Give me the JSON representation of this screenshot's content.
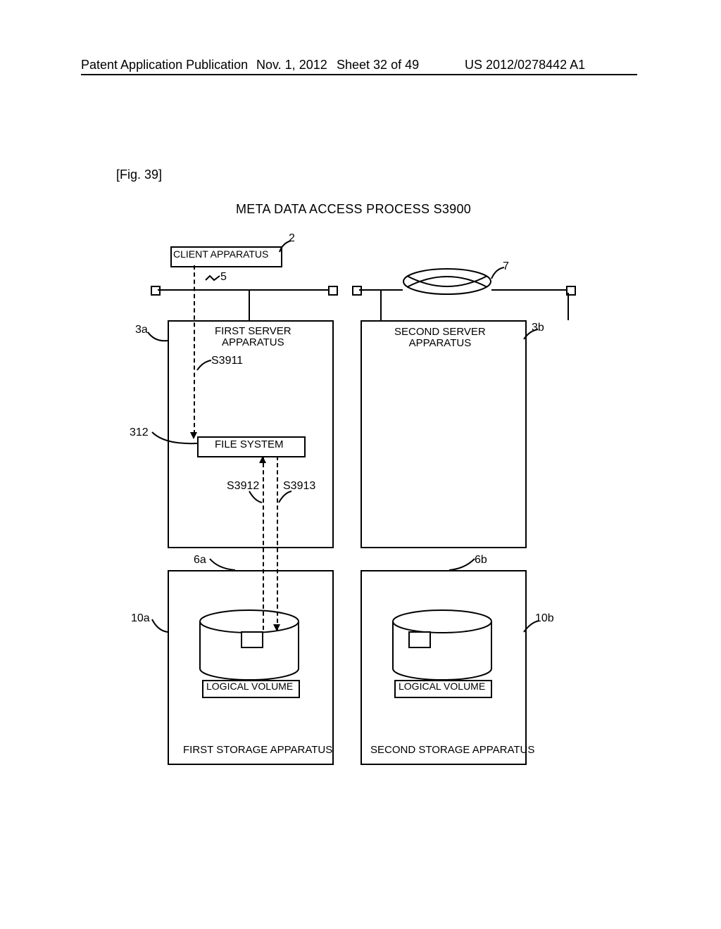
{
  "header": {
    "left": "Patent Application Publication",
    "date": "Nov. 1, 2012",
    "sheet": "Sheet 32 of 49",
    "pubno": "US 2012/0278442 A1"
  },
  "figure": {
    "label": "[Fig. 39]",
    "title": "META DATA ACCESS PROCESS S3900"
  },
  "boxes": {
    "client": "CLIENT APPARATUS",
    "server1": "FIRST SERVER\nAPPARATUS",
    "server2": "SECOND SERVER\nAPPARATUS",
    "filesystem": "FILE SYSTEM",
    "storage1": "FIRST STORAGE APPARATUS",
    "storage2": "SECOND STORAGE APPARATUS",
    "logical1": "LOGICAL VOLUME",
    "logical2": "LOGICAL VOLUME"
  },
  "refs": {
    "r2": "2",
    "r5": "5",
    "r7": "7",
    "r3a": "3a",
    "r3b": "3b",
    "r312": "312",
    "r6a": "6a",
    "r6b": "6b",
    "r10a": "10a",
    "r10b": "10b"
  },
  "steps": {
    "s3911": "S3911",
    "s3912": "S3912",
    "s3913": "S3913"
  }
}
